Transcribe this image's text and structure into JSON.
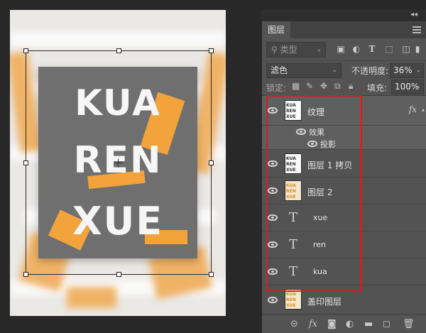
{
  "canvas": {
    "art_lines": [
      "KUA",
      "REN",
      "XUE"
    ],
    "accent_color": "#f2a03a",
    "card_color": "#6f6f6f"
  },
  "panel": {
    "collapse_glyph": "◂◂",
    "tab_label": "图层",
    "kind_filter": {
      "value": "类型"
    },
    "filter_icons": [
      "image-filter-icon",
      "adjustment-filter-icon",
      "type-filter-icon",
      "shape-filter-icon",
      "smart-object-filter-icon"
    ],
    "blend_mode": "滤色",
    "opacity_label": "不透明度:",
    "opacity_value": "36%",
    "lock_label": "锁定:",
    "fill_label": "填充:",
    "fill_value": "100%"
  },
  "layers": [
    {
      "name": "纹理",
      "kind": "image",
      "fx": "fx",
      "selected": true
    },
    {
      "name": "效果",
      "kind": "effect-group"
    },
    {
      "name": "投影",
      "kind": "effect"
    },
    {
      "name": "图层 1 拷贝",
      "kind": "image"
    },
    {
      "name": "图层 2",
      "kind": "image-orange"
    },
    {
      "name": "xue",
      "kind": "text"
    },
    {
      "name": "ren",
      "kind": "text"
    },
    {
      "name": "kua",
      "kind": "text"
    },
    {
      "name": "盖印图层",
      "kind": "image-orange"
    }
  ],
  "thumb_text": [
    "KUA",
    "REN",
    "XUE"
  ],
  "glyphs": {
    "text_layer": "T",
    "fx_arrow": "▴",
    "chevron": "⌄"
  },
  "footer_icons": [
    "link-icon",
    "fx-icon",
    "mask-icon",
    "adjustment-icon",
    "folder-icon",
    "new-layer-icon",
    "trash-icon"
  ]
}
